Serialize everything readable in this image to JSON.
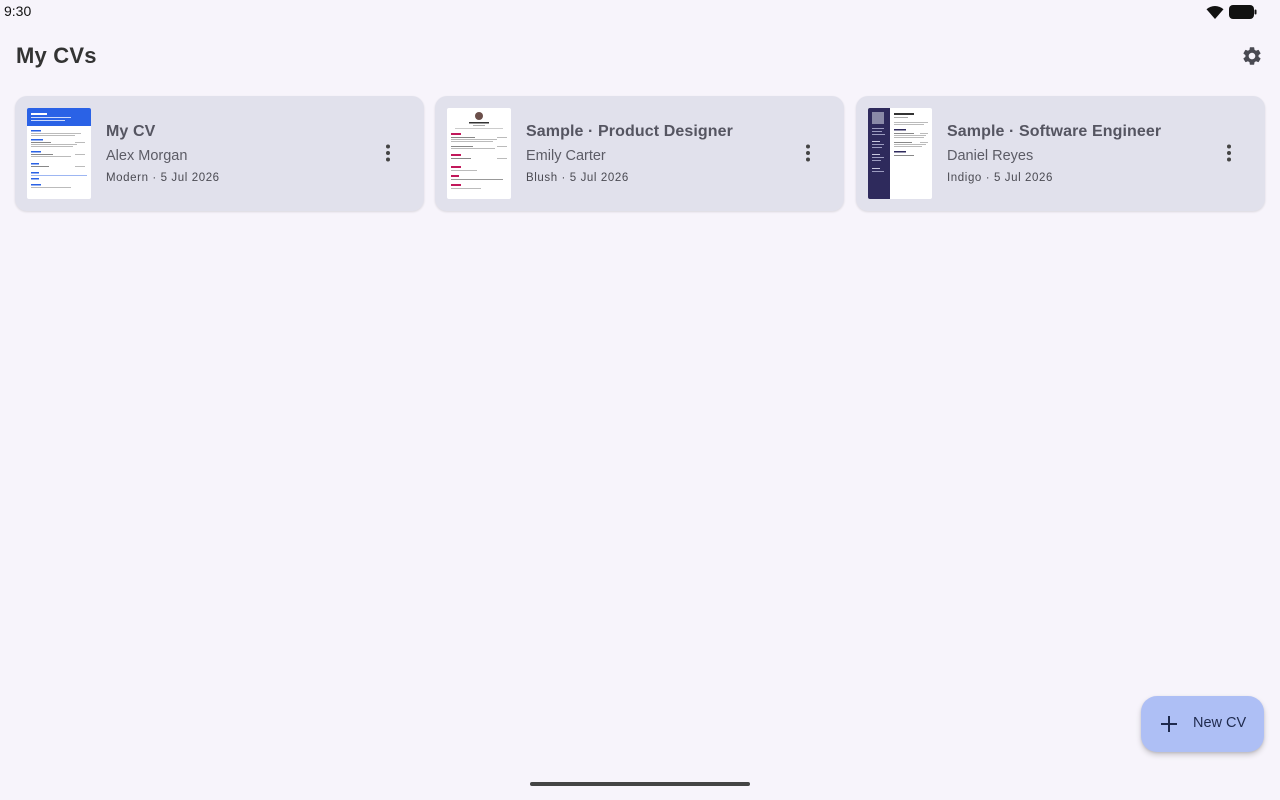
{
  "status_bar": {
    "time": "9:30"
  },
  "header": {
    "title": "My CVs",
    "settings_icon": "gear-icon"
  },
  "cvs": [
    {
      "title": "My CV",
      "name": "Alex Morgan",
      "meta": "Modern · 5 Jul 2026",
      "template_color": "#2962ff"
    },
    {
      "title": "Sample · Product Designer",
      "name": "Emily Carter",
      "meta": "Blush · 5 Jul 2026",
      "template_color": "#c2185b"
    },
    {
      "title": "Sample · Software Engineer",
      "name": "Daniel Reyes",
      "meta": "Indigo · 5 Jul 2026",
      "template_color": "#2e2a5c"
    }
  ],
  "fab": {
    "label": "New CV",
    "icon": "plus-icon"
  },
  "colors": {
    "background": "#f7f4fb",
    "card": "#e1e1ec",
    "fab": "#aebff5"
  }
}
